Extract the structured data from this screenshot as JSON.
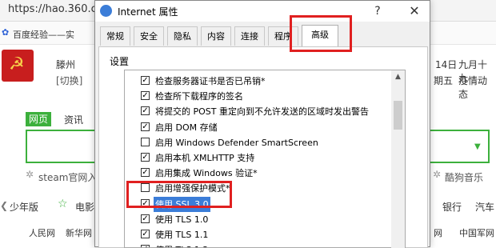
{
  "browser": {
    "url": "https://hao.360.com/",
    "bookmarks": [
      "百度经验——实"
    ],
    "city": "滕州",
    "switch_label": "[切换]",
    "date_day": "14日",
    "lunar": "九月十九",
    "weekday": "期五",
    "epidemic": "疫情动态",
    "search_tabs": [
      "网页",
      "资讯"
    ],
    "hint_left": "steam官网入",
    "hint_right": "酷狗音乐",
    "nav_items": [
      "少年版",
      "电影",
      "银行",
      "汽车"
    ],
    "site_links": [
      "人民网",
      "新华网",
      "网",
      "中国军网"
    ]
  },
  "dialog": {
    "title": "Internet 属性",
    "help_glyph": "?",
    "close_glyph": "✕",
    "tabs": [
      "常规",
      "安全",
      "隐私",
      "内容",
      "连接",
      "程序",
      "高级"
    ],
    "settings_label": "设置",
    "items": [
      {
        "label": "检查服务器证书是否已吊销*",
        "checked": true
      },
      {
        "label": "检查所下载程序的签名",
        "checked": true
      },
      {
        "label": "将提交的 POST 重定向到不允许发送的区域时发出警告",
        "checked": true
      },
      {
        "label": "启用 DOM 存储",
        "checked": true
      },
      {
        "label": "启用 Windows Defender SmartScreen",
        "checked": false
      },
      {
        "label": "启用本机 XMLHTTP 支持",
        "checked": true
      },
      {
        "label": "启用集成 Windows 验证*",
        "checked": true
      },
      {
        "label": "启用增强保护模式*",
        "checked": false
      },
      {
        "label": "使用 SSL 3.0",
        "checked": true
      },
      {
        "label": "使用 TLS 1.0",
        "checked": true
      },
      {
        "label": "使用 TLS 1.1",
        "checked": true
      },
      {
        "label": "使用 TLS 1.2",
        "checked": true
      }
    ]
  },
  "colors": {
    "highlight": "#e02020",
    "selection": "#3b7dd8",
    "brand_green": "#3cb03c"
  }
}
